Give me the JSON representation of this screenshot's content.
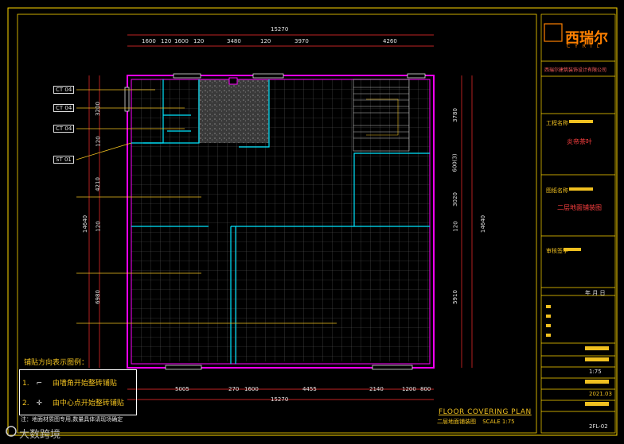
{
  "drawing": {
    "title_en": "FLOOR COVERING PLAN",
    "title_cn": "二层地面铺装图",
    "scale": "SCALE 1:75",
    "legend_title": "铺贴方向表示图例：",
    "legend_items": [
      {
        "num": "1.",
        "text": "由墙角开始整砖铺贴"
      },
      {
        "num": "2.",
        "text": "由中心点开始整砖铺贴"
      }
    ],
    "note": "注：地面材质图专用,数量具体请现场确定"
  },
  "dimensions": {
    "top_total": "15270",
    "top_segments": [
      "1600",
      "120",
      "1600",
      "120",
      "3480",
      "120",
      "3970",
      "4260"
    ],
    "bottom_total": "15270",
    "bottom_segments": [
      "5005",
      "270",
      "1600",
      "4455",
      "2140",
      "1200",
      "800"
    ],
    "left_total": "14640",
    "left_segments": [
      "3200",
      "120",
      "4210",
      "120",
      "6980"
    ],
    "right_total": "14640",
    "right_segments": [
      "3780",
      "600(3)",
      "3020",
      "120",
      "5910"
    ]
  },
  "tags": [
    {
      "code": "CT",
      "num": "04"
    },
    {
      "code": "CT",
      "num": "04"
    },
    {
      "code": "CT",
      "num": "04"
    },
    {
      "code": "ST",
      "num": "01"
    }
  ],
  "title_block": {
    "company_cn": "西瑞尔",
    "company_en": "CYRIL",
    "company_full": "西瑞尔建筑装饰设计有限公司",
    "project_label": "工程名称",
    "project_name": "炎帝茶叶",
    "drawing_label": "图纸名称",
    "drawing_name": "二层地面铺装图",
    "review_label": "审核签字",
    "date_row": "年 月 日",
    "scale_value": "1:75",
    "date_value": "2021.03",
    "sheet_number": "2FL-02"
  },
  "watermark": "大数跨境",
  "colors": {
    "frame": "#ffd700",
    "wall": "#ff00ff",
    "partition": "#00e5ff",
    "grid": "#6a6a6a",
    "dim": "#ff3030",
    "leader": "#f0c020"
  }
}
